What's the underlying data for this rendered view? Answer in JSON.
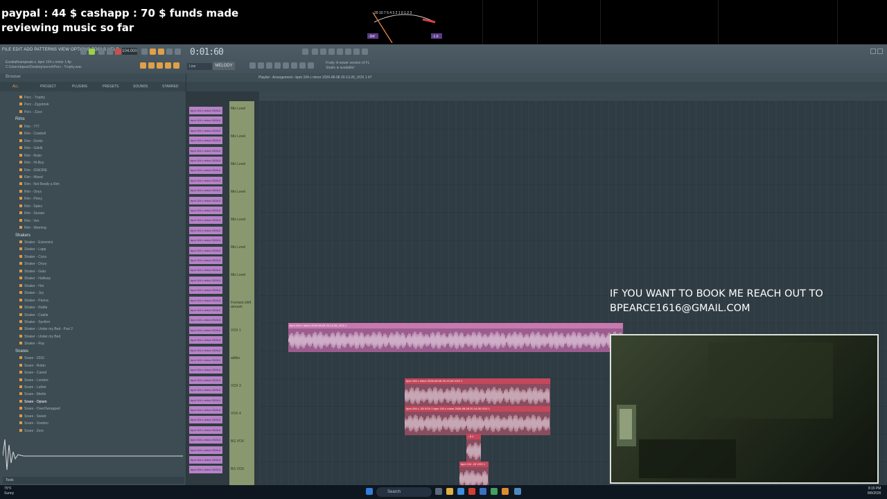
{
  "overlay": {
    "donation_text": "paypal : 44 $  cashapp : 70 $ funds made\nreviewing music so far",
    "booking_text": "IF YOU WANT TO BOOK ME REACH OUT TO\nBPEARCE1616@GMAIL.COM"
  },
  "vu_meter": {
    "scale": "20  10 7 5 4 3 2 1 0  1  2  3",
    "left_readout": "-3nf",
    "right_readout": "-1.6"
  },
  "fl": {
    "menu": "FILE  EDIT  ADD  PATTERNS  VIEW  OPTIONS  TOOLS  HELP",
    "bpm": "104.000",
    "time": "0:01:60",
    "project_path": "Exodialfeampeate.s. bpm 104 c minor 1.flp\nC:\\Users\\bpear\\Desktop\\secret\\Perc - Trophy.wav",
    "hint": "Fruity: A newer version of\nFL Studio is available!",
    "controller_mode": "Line",
    "pattern_name": "MELODY"
  },
  "browser": {
    "title": "Browser",
    "tabs": [
      "ALL",
      "PROJECT",
      "PLUGINS",
      "PRESETS",
      "SOUNDS",
      "STARRED"
    ],
    "tree": [
      {
        "type": "item",
        "label": "Perc - Trophy"
      },
      {
        "type": "item",
        "label": "Perc - Zygobrok"
      },
      {
        "type": "item",
        "label": "Perc - Zuco"
      },
      {
        "type": "folder",
        "label": "Rims"
      },
      {
        "type": "item",
        "label": "Rim - 777"
      },
      {
        "type": "item",
        "label": "Rim - Cowbell"
      },
      {
        "type": "item",
        "label": "Rim - Dorito"
      },
      {
        "type": "item",
        "label": "Rim - Gdelk"
      },
      {
        "type": "item",
        "label": "Rim - Ruler"
      },
      {
        "type": "item",
        "label": "Rim - Hi-Boy"
      },
      {
        "type": "item",
        "label": "Rim - IGNORE"
      },
      {
        "type": "item",
        "label": "Rim - Mixed"
      },
      {
        "type": "item",
        "label": "Rim - Not Really a Rim"
      },
      {
        "type": "item",
        "label": "Rim - Onyx"
      },
      {
        "type": "item",
        "label": "Rim - Pinny"
      },
      {
        "type": "item",
        "label": "Rim - Sales"
      },
      {
        "type": "item",
        "label": "Rim - Sunam"
      },
      {
        "type": "item",
        "label": "Rim - Vex"
      },
      {
        "type": "item",
        "label": "Rim - Warning"
      },
      {
        "type": "folder",
        "label": "Shakers"
      },
      {
        "type": "item",
        "label": "Shaker - Extremist"
      },
      {
        "type": "item",
        "label": "Shaker - Lapp"
      },
      {
        "type": "item",
        "label": "Shaker - Coca"
      },
      {
        "type": "item",
        "label": "Shaker - Drury"
      },
      {
        "type": "item",
        "label": "Shaker - Gala"
      },
      {
        "type": "item",
        "label": "Shaker - Halfway"
      },
      {
        "type": "item",
        "label": "Shaker - Hot"
      },
      {
        "type": "item",
        "label": "Shaker - Joy"
      },
      {
        "type": "item",
        "label": "Shaker - Panna"
      },
      {
        "type": "item",
        "label": "Shaker - Rattle"
      },
      {
        "type": "item",
        "label": "Shaker - Castle"
      },
      {
        "type": "item",
        "label": "Shaker - Synthm"
      },
      {
        "type": "item",
        "label": "Shaker - Under my Bed - Part 2"
      },
      {
        "type": "item",
        "label": "Shaker - Under my Bed"
      },
      {
        "type": "item",
        "label": "Shaker - Ray"
      },
      {
        "type": "folder",
        "label": "Snares"
      },
      {
        "type": "item",
        "label": "Snare - 2016"
      },
      {
        "type": "item",
        "label": "Snare - Robin"
      },
      {
        "type": "item",
        "label": "Snare - Camel"
      },
      {
        "type": "item",
        "label": "Snare - London"
      },
      {
        "type": "item",
        "label": "Snare - Luther"
      },
      {
        "type": "item",
        "label": "Snare - Merlin"
      },
      {
        "type": "item",
        "label": "Snare - Opium",
        "selected": true
      },
      {
        "type": "item",
        "label": "Snare - OverOwrapped"
      },
      {
        "type": "item",
        "label": "Snare - Sweet"
      },
      {
        "type": "item",
        "label": "Snare - Voodoo"
      },
      {
        "type": "item",
        "label": "Snare - Zero"
      }
    ],
    "search_value": "Tools"
  },
  "playlist": {
    "title": "Playlist - Arrangement › bpm 104 c minor 2026-08-08 20-13-26_VOX 1 #7",
    "clip_label": "bpm 104 c minor 2026-0",
    "clip_count": 37,
    "tracks": [
      {
        "label": "Mix Level",
        "row": 0
      },
      {
        "label": "Mix Level",
        "row": 1
      },
      {
        "label": "Mix Level",
        "row": 2
      },
      {
        "label": "Mix Level",
        "row": 3
      },
      {
        "label": "Mix Level",
        "row": 4
      },
      {
        "label": "Mix Level",
        "row": 5
      },
      {
        "label": "Mix Level",
        "row": 6
      },
      {
        "label": "Formant shift amount",
        "row": 7
      },
      {
        "label": "VOX 1",
        "row": 8
      },
      {
        "label": "adlibs",
        "row": 9
      },
      {
        "label": "VOX 3",
        "row": 10
      },
      {
        "label": "VOX 4",
        "row": 11
      },
      {
        "label": "BG VOX",
        "row": 12
      },
      {
        "label": "BG VOX",
        "row": 13
      }
    ],
    "clips": [
      {
        "name": "bpm 104 c minor 2026-08-08 20-14-26_VOX 1",
        "color": "purple",
        "start": 4,
        "len": 46,
        "row": 8
      },
      {
        "name": "bpm 104 c minor 2026-08-08 20-13-26 VOX 1",
        "color": "red",
        "start": 20,
        "len": 20,
        "row": 10
      },
      {
        "name": "bpm 104 c -28 VOX 1  bpm 104 c minor 2026-08-08 20-14-50 VOX 1",
        "color": "red",
        "start": 20,
        "len": 20,
        "row": 11
      },
      {
        "name": "- 8 1",
        "color": "red",
        "start": 28.5,
        "len": 2,
        "row": 12
      },
      {
        "name": "bpm 104 -15 VOX 1",
        "color": "red",
        "start": 27.5,
        "len": 4,
        "row": 13
      }
    ]
  },
  "taskbar": {
    "weather": "75°F\nSunny",
    "search_placeholder": "Search",
    "clock": "8:15 PM\n8/8/2026"
  }
}
